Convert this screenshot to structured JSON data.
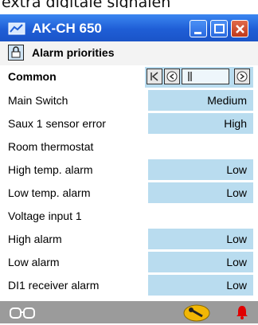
{
  "caption": "extra digitale signalen",
  "window": {
    "title": "AK-CH 650"
  },
  "header": {
    "title": "Alarm priorities"
  },
  "group": {
    "label": "Common"
  },
  "rows": [
    {
      "label": "Main Switch",
      "value": "Medium"
    },
    {
      "label": "Saux 1 sensor error",
      "value": "High"
    },
    {
      "label": "Room thermostat",
      "value": null
    },
    {
      "label": "High temp. alarm",
      "value": "Low"
    },
    {
      "label": "Low temp. alarm",
      "value": "Low"
    },
    {
      "label": "Voltage input 1",
      "value": null
    },
    {
      "label": "High alarm",
      "value": "Low"
    },
    {
      "label": "Low alarm",
      "value": "Low"
    },
    {
      "label": "DI1 receiver alarm",
      "value": "Low"
    }
  ],
  "colors": {
    "titlebar": "#1f5ed6",
    "value_cell": "#b9dcef",
    "statusbar": "#9b9b9b",
    "bell": "#e00000",
    "key": "#f2b705"
  },
  "icons": [
    "app-icon",
    "lock-icon",
    "first-page-icon",
    "prev-icon",
    "next-icon",
    "glasses-icon",
    "key-icon",
    "bell-icon"
  ]
}
